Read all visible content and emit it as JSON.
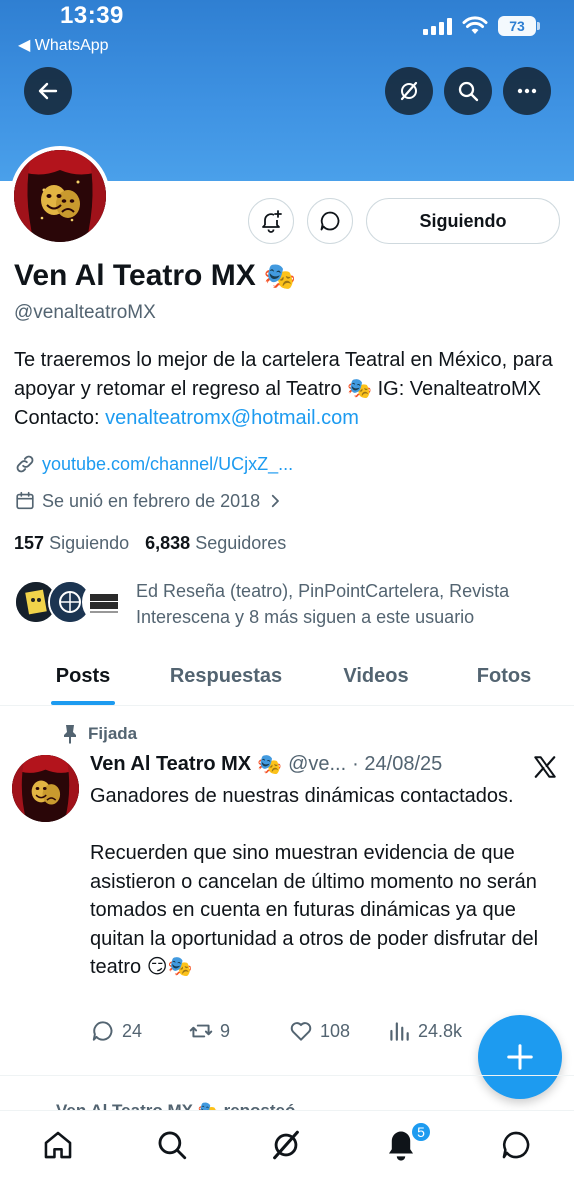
{
  "status_bar": {
    "time": "13:39",
    "back_app": "◀ WhatsApp",
    "battery": "73"
  },
  "profile": {
    "name": "Ven Al Teatro MX",
    "name_emoji": "🎭",
    "handle": "@venalteatroMX",
    "bio_text": "Te traeremos lo mejor de la cartelera Teatral en México, para apoyar y retomar el regreso al Teatro 🎭 IG: VenalteatroMX Contacto: ",
    "bio_email": "venalteatromx@hotmail.com",
    "website": "youtube.com/channel/UCjxZ_...",
    "joined": "Se unió en febrero de 2018",
    "following_count": "157",
    "following_label": "Siguiendo",
    "followers_count": "6,838",
    "followers_label": "Seguidores",
    "known_followers": "Ed Reseña (teatro), PinPointCartelera, Revista Interescena y 8 más siguen a este usuario",
    "follow_button": "Siguiendo"
  },
  "tabs": [
    {
      "label": "Posts",
      "active": true
    },
    {
      "label": "Respuestas",
      "active": false
    },
    {
      "label": "Videos",
      "active": false
    },
    {
      "label": "Fotos",
      "active": false
    }
  ],
  "post": {
    "pinned_label": "Fijada",
    "author": "Ven Al Teatro MX",
    "author_emoji": "🎭",
    "handle": "@ve...",
    "date": "· 24/08/25",
    "body": "Ganadores de nuestras dinámicas contactados.\n\nRecuerden que sino muestran evidencia de que asistieron o cancelan de último momento no serán tomados en cuenta en futuras dinámicas ya que quitan la oportunidad a otros de poder disfrutar del teatro 😏🎭",
    "replies": "24",
    "reposts": "9",
    "likes": "108",
    "views": "24.8k"
  },
  "next_post_preview": "Ven Al Teatro MX 🎭 reposteó",
  "nav": {
    "notifications_badge": "5"
  },
  "colors": {
    "accent": "#1d9bf0",
    "banner": "#3f93e3",
    "text": "#0f1419",
    "muted": "#536471"
  }
}
